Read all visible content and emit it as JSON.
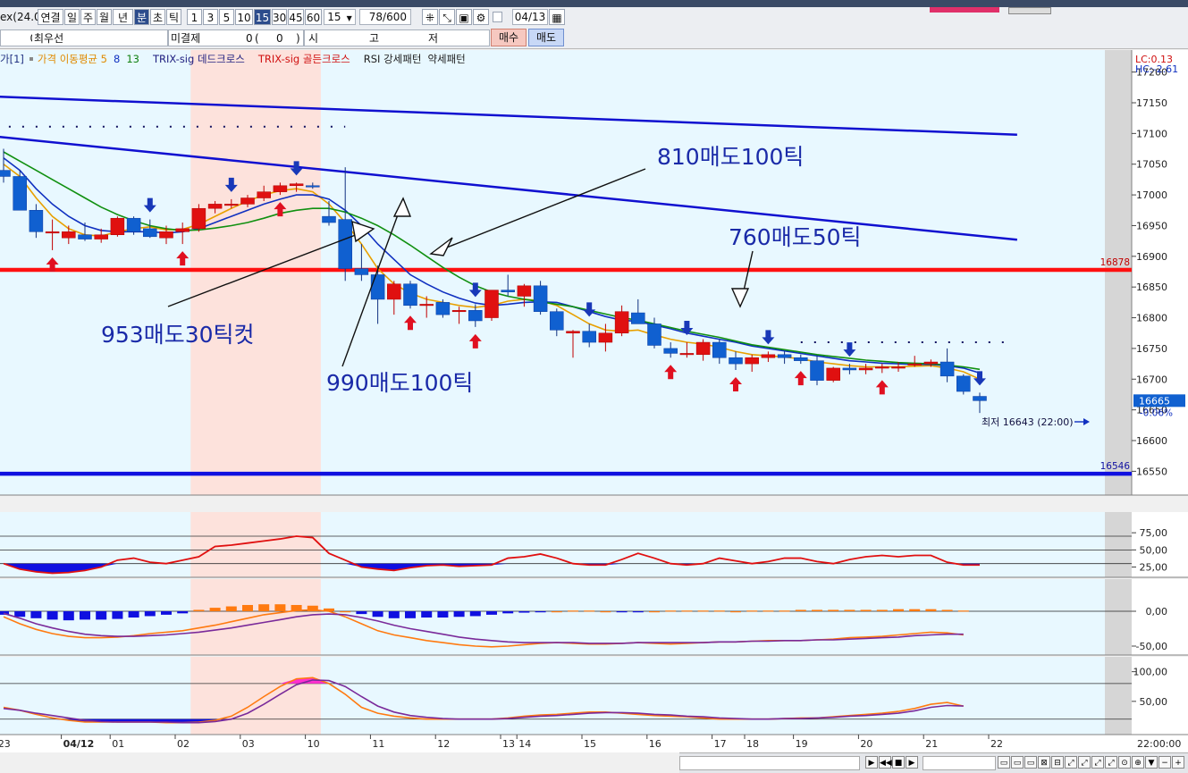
{
  "toolbar": {
    "symbol_fragment": "ex(24.0",
    "period_buttons": [
      "연결",
      "일",
      "주",
      "월",
      "년",
      "분",
      "초",
      "틱"
    ],
    "active_period": "분",
    "interval_buttons": [
      "1",
      "3",
      "5",
      "10",
      "15",
      "30",
      "45",
      "60"
    ],
    "active_interval": "15",
    "interval_select": "15",
    "count_value": "78",
    "count_total": "/600",
    "date_value": "04/13"
  },
  "quote_row": {
    "change_pct": "0%",
    "best_price_label": "최우선",
    "open_interest_label": "미결제",
    "open_interest_value": "0",
    "oi_change_open": "(",
    "oi_change_value": "0",
    "oi_change_close": ")",
    "open_label": "시",
    "high_label": "고",
    "low_label": "저",
    "buy_button": "매수",
    "sell_button": "매도"
  },
  "legend": {
    "prefix": "가[1]",
    "items": [
      {
        "label": "가격 이동평균 5",
        "color": "#e08a00"
      },
      {
        "label": "8",
        "color": "#1030c0"
      },
      {
        "label": "13",
        "color": "#108010"
      },
      {
        "label": "TRIX-sig 데드크로스",
        "color": "#202080"
      },
      {
        "label": "TRIX-sig 골든크로스",
        "color": "#d01010"
      },
      {
        "label": "RSI 강세패턴",
        "color": "#202020"
      },
      {
        "label": "약세패턴",
        "color": "#202020"
      }
    ]
  },
  "chart_data": {
    "type": "candlestick",
    "interval": "15분",
    "ylim": [
      16520,
      17230
    ],
    "y_ticks": [
      17200,
      17150,
      17100,
      17050,
      17000,
      16950,
      16900,
      16850,
      16800,
      16750,
      16700,
      16650,
      16600,
      16550
    ],
    "corner_labels": {
      "lc": "LC:0.13",
      "hc": "HC:-2.61"
    },
    "x_labels": [
      {
        "label": "23",
        "index": 0
      },
      {
        "label": "04/12",
        "index": 4
      },
      {
        "label": "01",
        "index": 7
      },
      {
        "label": "02",
        "index": 11
      },
      {
        "label": "03",
        "index": 15
      },
      {
        "label": "10",
        "index": 19
      },
      {
        "label": "11",
        "index": 23
      },
      {
        "label": "12",
        "index": 27
      },
      {
        "label": "13",
        "index": 31
      },
      {
        "label": "14",
        "index": 32
      },
      {
        "label": "15",
        "index": 36
      },
      {
        "label": "16",
        "index": 40
      },
      {
        "label": "17",
        "index": 44
      },
      {
        "label": "18",
        "index": 46
      },
      {
        "label": "19",
        "index": 49
      },
      {
        "label": "20",
        "index": 53
      },
      {
        "label": "21",
        "index": 57
      },
      {
        "label": "22",
        "index": 61
      }
    ],
    "time_label": "22:00:00",
    "shaded_session": {
      "start_index": 12,
      "end_index": 19
    },
    "candles": [
      {
        "o": 17040,
        "h": 17075,
        "l": 17020,
        "c": 17030
      },
      {
        "o": 17030,
        "h": 17040,
        "l": 16975,
        "c": 16975
      },
      {
        "o": 16975,
        "h": 16985,
        "l": 16930,
        "c": 16940
      },
      {
        "o": 16940,
        "h": 16960,
        "l": 16910,
        "c": 16940
      },
      {
        "o": 16930,
        "h": 16950,
        "l": 16920,
        "c": 16940
      },
      {
        "o": 16935,
        "h": 16955,
        "l": 16925,
        "c": 16928
      },
      {
        "o": 16928,
        "h": 16945,
        "l": 16922,
        "c": 16935
      },
      {
        "o": 16935,
        "h": 16965,
        "l": 16932,
        "c": 16962
      },
      {
        "o": 16962,
        "h": 16965,
        "l": 16935,
        "c": 16940
      },
      {
        "o": 16945,
        "h": 16960,
        "l": 16930,
        "c": 16932
      },
      {
        "o": 16930,
        "h": 16950,
        "l": 16920,
        "c": 16940
      },
      {
        "o": 16940,
        "h": 16955,
        "l": 16920,
        "c": 16945
      },
      {
        "o": 16945,
        "h": 16985,
        "l": 16940,
        "c": 16978
      },
      {
        "o": 16978,
        "h": 16990,
        "l": 16970,
        "c": 16985
      },
      {
        "o": 16983,
        "h": 16993,
        "l": 16978,
        "c": 16985
      },
      {
        "o": 16985,
        "h": 17000,
        "l": 16980,
        "c": 16995
      },
      {
        "o": 16995,
        "h": 17015,
        "l": 16990,
        "c": 17005
      },
      {
        "o": 17005,
        "h": 17020,
        "l": 17000,
        "c": 17015
      },
      {
        "o": 17015,
        "h": 17020,
        "l": 17005,
        "c": 17018
      },
      {
        "o": 17015,
        "h": 17020,
        "l": 17010,
        "c": 17013
      },
      {
        "o": 16965,
        "h": 16990,
        "l": 16950,
        "c": 16955
      },
      {
        "o": 16960,
        "h": 17045,
        "l": 16860,
        "c": 16880
      },
      {
        "o": 16880,
        "h": 16920,
        "l": 16860,
        "c": 16870
      },
      {
        "o": 16870,
        "h": 16885,
        "l": 16790,
        "c": 16830
      },
      {
        "o": 16830,
        "h": 16860,
        "l": 16805,
        "c": 16855
      },
      {
        "o": 16855,
        "h": 16860,
        "l": 16815,
        "c": 16820
      },
      {
        "o": 16820,
        "h": 16835,
        "l": 16800,
        "c": 16822
      },
      {
        "o": 16825,
        "h": 16830,
        "l": 16800,
        "c": 16805
      },
      {
        "o": 16810,
        "h": 16818,
        "l": 16790,
        "c": 16812
      },
      {
        "o": 16812,
        "h": 16822,
        "l": 16785,
        "c": 16795
      },
      {
        "o": 16800,
        "h": 16830,
        "l": 16795,
        "c": 16845
      },
      {
        "o": 16845,
        "h": 16870,
        "l": 16835,
        "c": 16842
      },
      {
        "o": 16835,
        "h": 16855,
        "l": 16818,
        "c": 16852
      },
      {
        "o": 16852,
        "h": 16860,
        "l": 16805,
        "c": 16810
      },
      {
        "o": 16810,
        "h": 16815,
        "l": 16770,
        "c": 16780
      },
      {
        "o": 16775,
        "h": 16780,
        "l": 16735,
        "c": 16778
      },
      {
        "o": 16778,
        "h": 16790,
        "l": 16752,
        "c": 16760
      },
      {
        "o": 16760,
        "h": 16790,
        "l": 16745,
        "c": 16775
      },
      {
        "o": 16775,
        "h": 16820,
        "l": 16770,
        "c": 16810
      },
      {
        "o": 16808,
        "h": 16830,
        "l": 16795,
        "c": 16790
      },
      {
        "o": 16790,
        "h": 16800,
        "l": 16750,
        "c": 16755
      },
      {
        "o": 16750,
        "h": 16760,
        "l": 16735,
        "c": 16742
      },
      {
        "o": 16742,
        "h": 16760,
        "l": 16735,
        "c": 16742
      },
      {
        "o": 16740,
        "h": 16765,
        "l": 16730,
        "c": 16760
      },
      {
        "o": 16760,
        "h": 16765,
        "l": 16725,
        "c": 16735
      },
      {
        "o": 16735,
        "h": 16745,
        "l": 16715,
        "c": 16725
      },
      {
        "o": 16725,
        "h": 16740,
        "l": 16712,
        "c": 16735
      },
      {
        "o": 16735,
        "h": 16745,
        "l": 16728,
        "c": 16740
      },
      {
        "o": 16740,
        "h": 16745,
        "l": 16725,
        "c": 16735
      },
      {
        "o": 16735,
        "h": 16740,
        "l": 16725,
        "c": 16730
      },
      {
        "o": 16730,
        "h": 16738,
        "l": 16690,
        "c": 16698
      },
      {
        "o": 16698,
        "h": 16720,
        "l": 16695,
        "c": 16718
      },
      {
        "o": 16718,
        "h": 16725,
        "l": 16708,
        "c": 16715
      },
      {
        "o": 16715,
        "h": 16725,
        "l": 16708,
        "c": 16718
      },
      {
        "o": 16718,
        "h": 16725,
        "l": 16710,
        "c": 16720
      },
      {
        "o": 16720,
        "h": 16728,
        "l": 16712,
        "c": 16720
      },
      {
        "o": 16725,
        "h": 16738,
        "l": 16720,
        "c": 16725
      },
      {
        "o": 16725,
        "h": 16732,
        "l": 16720,
        "c": 16728
      },
      {
        "o": 16728,
        "h": 16750,
        "l": 16695,
        "c": 16705
      },
      {
        "o": 16705,
        "h": 16708,
        "l": 16675,
        "c": 16680
      },
      {
        "o": 16672,
        "h": 16678,
        "l": 16645,
        "c": 16665
      }
    ],
    "moving_averages": [
      {
        "name": "5",
        "color": "#e8a000",
        "values": [
          17050,
          17030,
          16995,
          16965,
          16945,
          16935,
          16933,
          16940,
          16945,
          16948,
          16943,
          16944,
          16952,
          16965,
          16978,
          16990,
          17000,
          17007,
          17010,
          17005,
          16985,
          16955,
          16920,
          16880,
          16855,
          16840,
          16830,
          16825,
          16820,
          16817,
          16820,
          16827,
          16830,
          16828,
          16820,
          16805,
          16790,
          16780,
          16778,
          16780,
          16772,
          16765,
          16760,
          16757,
          16752,
          16745,
          16740,
          16738,
          16736,
          16733,
          16728,
          16725,
          16722,
          16720,
          16720,
          16720,
          16721,
          16722,
          16718,
          16712,
          16700
        ]
      },
      {
        "name": "8",
        "color": "#1030c0",
        "values": [
          17060,
          17040,
          17010,
          16985,
          16965,
          16950,
          16942,
          16940,
          16940,
          16940,
          16938,
          16940,
          16945,
          16955,
          16965,
          16975,
          16985,
          16993,
          17000,
          17000,
          16993,
          16975,
          16950,
          16920,
          16895,
          16870,
          16855,
          16842,
          16832,
          16824,
          16820,
          16822,
          16825,
          16826,
          16825,
          16818,
          16810,
          16802,
          16796,
          16794,
          16788,
          16782,
          16775,
          16770,
          16765,
          16760,
          16754,
          16750,
          16746,
          16742,
          16738,
          16734,
          16730,
          16728,
          16726,
          16725,
          16724,
          16724,
          16722,
          16718,
          16710
        ]
      },
      {
        "name": "13",
        "color": "#109010",
        "values": [
          17070,
          17055,
          17040,
          17025,
          17010,
          16995,
          16980,
          16968,
          16958,
          16950,
          16945,
          16942,
          16943,
          16946,
          16950,
          16955,
          16962,
          16970,
          16975,
          16978,
          16978,
          16972,
          16962,
          16950,
          16935,
          16918,
          16900,
          16882,
          16866,
          16852,
          16842,
          16835,
          16830,
          16826,
          16822,
          16818,
          16812,
          16806,
          16800,
          16796,
          16790,
          16784,
          16778,
          16773,
          16768,
          16762,
          16756,
          16752,
          16748,
          16744,
          16740,
          16737,
          16734,
          16731,
          16729,
          16727,
          16726,
          16725,
          16723,
          16720,
          16716
        ]
      }
    ],
    "horizontal_levels": [
      {
        "value": 16878,
        "label": "16878",
        "color": "#ff1010"
      },
      {
        "value": 16546,
        "label": "16546",
        "color": "#1010e0"
      }
    ],
    "trend_lines": [
      {
        "from": {
          "index": -0.5,
          "value": 17160
        },
        "to": {
          "index": 62.3,
          "value": 17098
        },
        "color": "#1010d0"
      },
      {
        "from": {
          "index": -0.5,
          "value": 17095
        },
        "to": {
          "index": 62.3,
          "value": 16927
        },
        "color": "#1010d0"
      }
    ],
    "dotted_levels": [
      {
        "value": 17111,
        "from_index": -0.5,
        "to_index": 21
      },
      {
        "value": 16760,
        "from_index": 49,
        "to_index": 62
      }
    ],
    "up_arrows": [
      3,
      11,
      17,
      25,
      29,
      41,
      45,
      49,
      54
    ],
    "down_arrows": [
      9,
      14,
      18,
      29,
      36,
      42,
      47,
      52,
      60
    ],
    "last_price": {
      "label": "16665",
      "change": "-0.06%"
    },
    "low_annotation": "최저 16643 (22:00)",
    "annotations": [
      {
        "text": "810매도100틱"
      },
      {
        "text": "760매도50틱"
      },
      {
        "text": "953매도30틱컷"
      },
      {
        "text": "990매도100틱"
      }
    ],
    "panels": [
      {
        "name": "RSI",
        "ylim": [
          0,
          100
        ],
        "ticks": [
          75,
          50,
          25
        ],
        "tick_labels": [
          "75,00",
          "50,00",
          "25,00"
        ],
        "lines": [
          70,
          50,
          30
        ],
        "values": [
          30,
          22,
          18,
          16,
          17,
          20,
          25,
          35,
          38,
          32,
          30,
          35,
          40,
          55,
          57,
          60,
          63,
          66,
          70,
          68,
          45,
          35,
          25,
          22,
          20,
          24,
          27,
          28,
          26,
          27,
          28,
          38,
          40,
          44,
          38,
          30,
          28,
          28,
          36,
          45,
          38,
          30,
          28,
          30,
          38,
          34,
          30,
          33,
          38,
          38,
          33,
          30,
          36,
          40,
          42,
          40,
          42,
          42,
          32,
          28,
          28
        ],
        "fill_below": 30
      },
      {
        "name": "MACD",
        "ylim": [
          -75,
          20
        ],
        "ticks": [
          0,
          -50
        ],
        "tick_labels": [
          "0,00",
          "-50,00"
        ],
        "bars": [
          -5,
          -8,
          -10,
          -12,
          -13,
          -12,
          -12,
          -11,
          -9,
          -7,
          -5,
          -3,
          2,
          5,
          7,
          9,
          10,
          10,
          9,
          8,
          4,
          0,
          -4,
          -8,
          -10,
          -10,
          -9,
          -9,
          -8,
          -7,
          -5,
          -3,
          -2,
          -1,
          0,
          1,
          1,
          0,
          -1,
          -1,
          0,
          1,
          1,
          1,
          1,
          0,
          1,
          1,
          1,
          2,
          2,
          2,
          2,
          2,
          2,
          3,
          3,
          3,
          2,
          1
        ],
        "macd": [
          -8,
          -18,
          -26,
          -32,
          -36,
          -38,
          -38,
          -37,
          -35,
          -32,
          -30,
          -28,
          -24,
          -20,
          -15,
          -10,
          -5,
          -2,
          1,
          2,
          0,
          -8,
          -18,
          -28,
          -34,
          -38,
          -42,
          -45,
          -48,
          -50,
          -51,
          -50,
          -48,
          -46,
          -45,
          -46,
          -47,
          -47,
          -46,
          -45,
          -46,
          -47,
          -46,
          -45,
          -44,
          -44,
          -43,
          -42,
          -42,
          -42,
          -41,
          -40,
          -38,
          -37,
          -36,
          -34,
          -32,
          -30,
          -31,
          -34
        ],
        "signal": [
          -3,
          -10,
          -18,
          -24,
          -29,
          -33,
          -35,
          -36,
          -36,
          -35,
          -34,
          -32,
          -30,
          -27,
          -24,
          -20,
          -16,
          -12,
          -8,
          -5,
          -4,
          -5,
          -9,
          -14,
          -20,
          -25,
          -29,
          -33,
          -37,
          -40,
          -42,
          -44,
          -45,
          -45,
          -45,
          -45,
          -46,
          -46,
          -46,
          -45,
          -45,
          -45,
          -45,
          -45,
          -44,
          -44,
          -43,
          -43,
          -42,
          -42,
          -41,
          -41,
          -40,
          -39,
          -38,
          -37,
          -35,
          -34,
          -33,
          -33
        ]
      },
      {
        "name": "Stochastic",
        "ylim": [
          0,
          120
        ],
        "ticks": [
          100,
          50
        ],
        "tick_labels": [
          "100,00",
          "50,00"
        ],
        "lines": [
          80,
          20
        ],
        "k": [
          40,
          35,
          28,
          22,
          18,
          15,
          15,
          15,
          15,
          15,
          14,
          14,
          15,
          18,
          25,
          40,
          58,
          75,
          88,
          90,
          80,
          62,
          40,
          30,
          25,
          22,
          20,
          20,
          20,
          20,
          20,
          22,
          25,
          27,
          28,
          30,
          32,
          32,
          30,
          28,
          26,
          25,
          24,
          22,
          20,
          20,
          20,
          20,
          21,
          22,
          22,
          24,
          26,
          28,
          30,
          33,
          38,
          45,
          48,
          42
        ],
        "d": [
          38,
          35,
          30,
          26,
          22,
          18,
          16,
          15,
          15,
          15,
          15,
          14,
          14,
          16,
          20,
          30,
          45,
          62,
          78,
          86,
          85,
          75,
          58,
          42,
          32,
          26,
          23,
          21,
          20,
          20,
          20,
          21,
          23,
          25,
          26,
          28,
          30,
          31,
          31,
          30,
          28,
          27,
          25,
          24,
          22,
          21,
          20,
          20,
          21,
          21,
          22,
          23,
          25,
          26,
          28,
          30,
          34,
          40,
          43,
          42
        ]
      }
    ]
  }
}
